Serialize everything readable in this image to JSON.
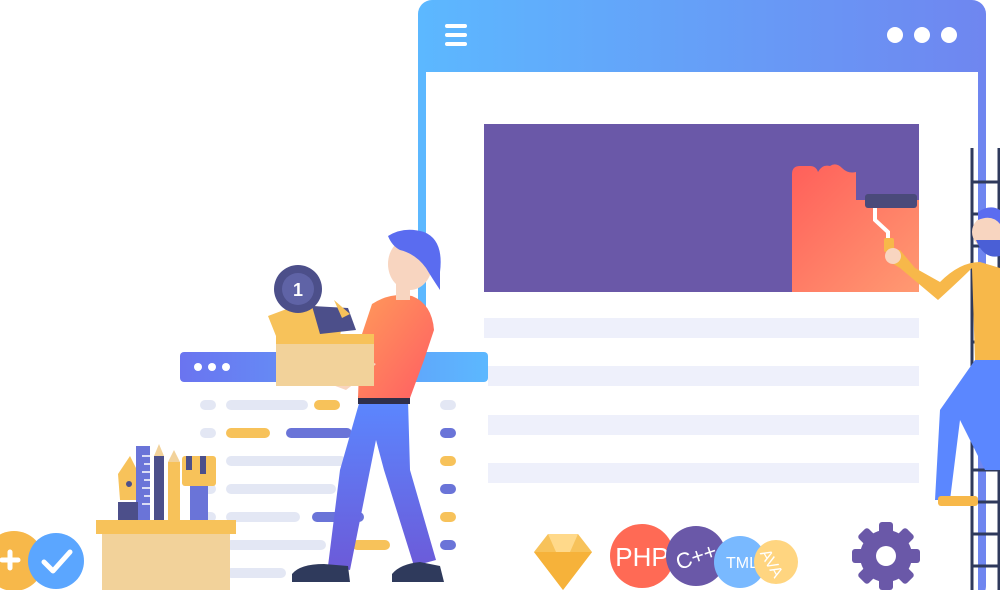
{
  "illustration": {
    "browser_window": {
      "menu_icon": "hamburger-menu-icon",
      "window_controls": [
        "dot",
        "dot",
        "dot"
      ],
      "accent": "#5cb8ff",
      "hero_color": "#6a58a8",
      "paint_color": "#ff6f5e"
    },
    "code_window": {
      "window_controls": [
        "dot",
        "dot",
        "dot"
      ],
      "accent": "#5a8cf2"
    },
    "languages": [
      {
        "label": "PHP",
        "color": "#ff6a55"
      },
      {
        "label": "C++",
        "color": "#6a58a8"
      },
      {
        "label": "TML",
        "color": "#79b9ff"
      },
      {
        "label": "AVA",
        "color": "#ffd580"
      }
    ],
    "box_badge": "1",
    "icons": [
      "check-icon",
      "wrench-icon",
      "gear-icon",
      "gem-icon"
    ]
  }
}
